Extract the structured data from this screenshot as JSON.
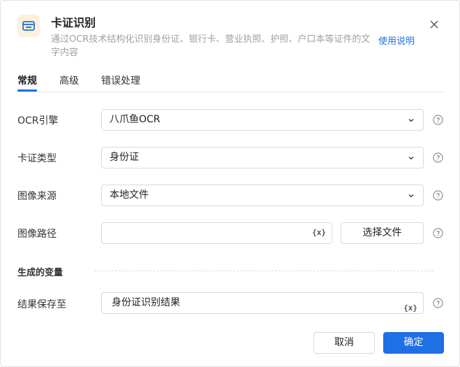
{
  "header": {
    "title": "卡证识别",
    "description": "通过OCR技术结构化识别身份证、银行卡、营业执照、护照、户口本等证件的文字内容",
    "help_link": "使用说明",
    "icon": "id-card-icon",
    "icon_bg": "#fdf1dc",
    "icon_color": "#1f6fe5"
  },
  "tabs": [
    {
      "label": "常规",
      "active": true
    },
    {
      "label": "高级",
      "active": false
    },
    {
      "label": "错误处理",
      "active": false
    }
  ],
  "form": {
    "ocr_engine": {
      "label": "OCR引擎",
      "value": "八爪鱼OCR"
    },
    "card_type": {
      "label": "卡证类型",
      "value": "身份证"
    },
    "image_source": {
      "label": "图像来源",
      "value": "本地文件"
    },
    "image_path": {
      "label": "图像路径",
      "value": "",
      "button": "选择文件"
    }
  },
  "variables": {
    "section_title": "生成的变量",
    "save_to": {
      "label": "结果保存至",
      "value": "身份证识别结果"
    }
  },
  "var_icon_text": "{x}",
  "footer": {
    "cancel": "取消",
    "confirm": "确定"
  },
  "colors": {
    "primary": "#1f6fe5",
    "border": "#d9d9d9",
    "muted_text": "#a0a0a0"
  }
}
